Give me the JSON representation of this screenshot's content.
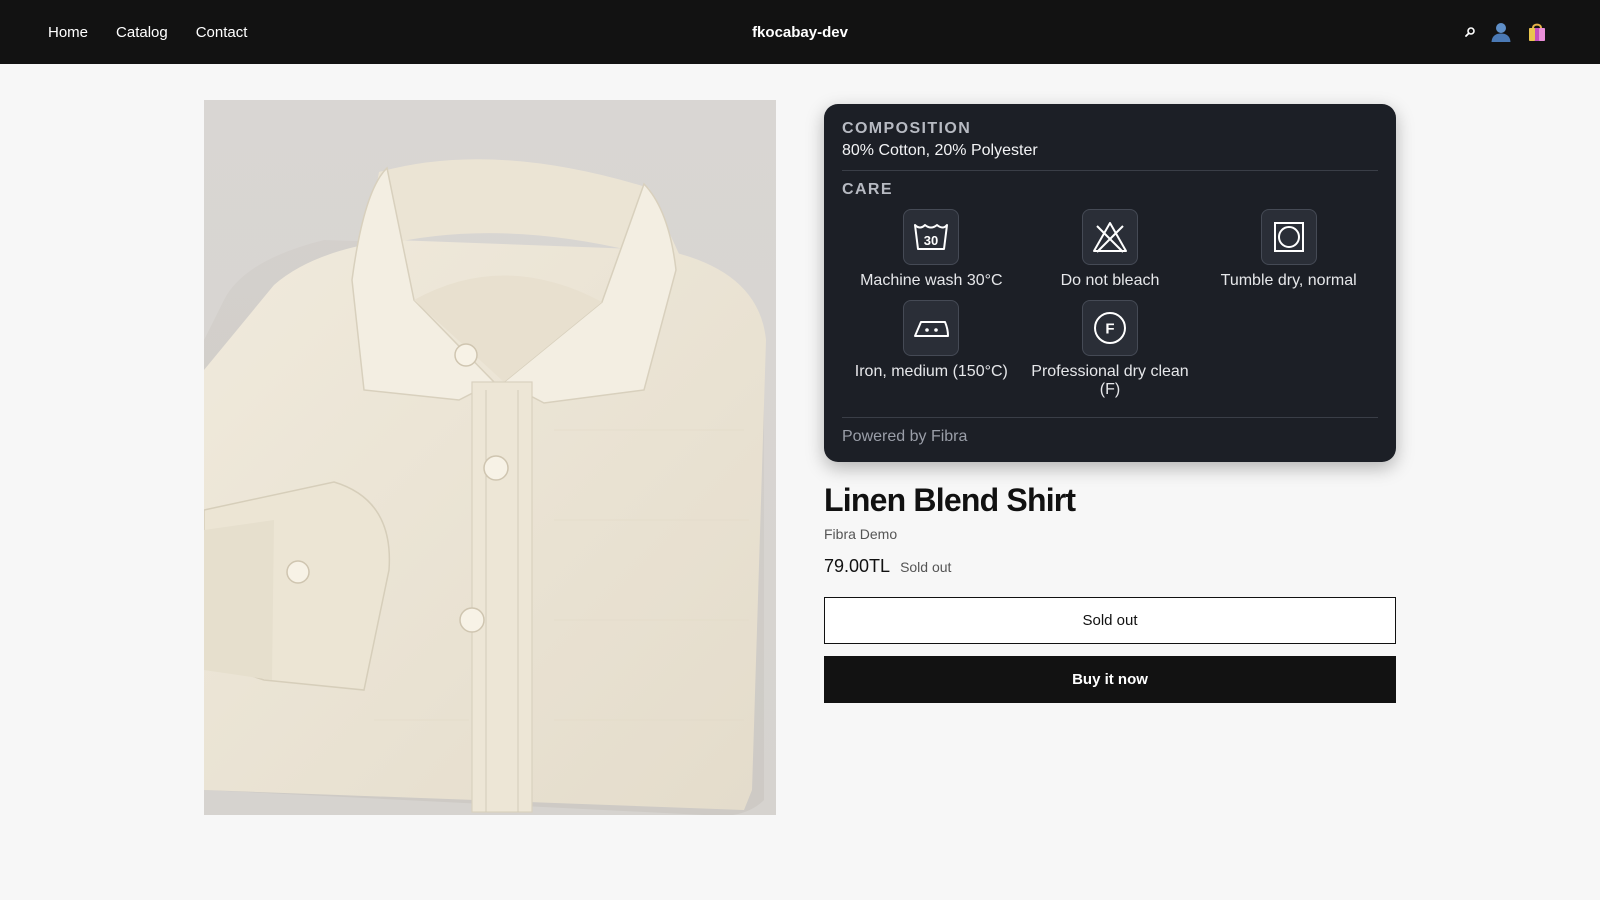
{
  "header": {
    "nav": [
      "Home",
      "Catalog",
      "Contact"
    ],
    "brand": "fkocabay-dev",
    "icons": [
      "search-icon",
      "account-icon",
      "cart-icon"
    ]
  },
  "product": {
    "title": "Linen Blend Shirt",
    "vendor": "Fibra Demo",
    "price": "79.00TL",
    "badge": "Sold out",
    "sold_out_button": "Sold out",
    "buy_now_button": "Buy it now"
  },
  "fibra": {
    "composition_label": "COMPOSITION",
    "composition_value": "80% Cotton, 20% Polyester",
    "care_label": "CARE",
    "care": [
      {
        "icon": "wash-30-icon",
        "label": "Machine wash 30°C",
        "symbol": "30"
      },
      {
        "icon": "no-bleach-icon",
        "label": "Do not bleach"
      },
      {
        "icon": "tumble-dry-icon",
        "label": "Tumble dry, normal"
      },
      {
        "icon": "iron-medium-icon",
        "label": "Iron, medium (150°C)"
      },
      {
        "icon": "dry-clean-f-icon",
        "label": "Professional dry clean (F)",
        "symbol": "F"
      }
    ],
    "powered_by": "Powered by Fibra"
  },
  "colors": {
    "header_bg": "#121212",
    "card_bg": "#1c1f26",
    "page_bg": "#f7f7f7",
    "cart_accent": "#c44fbf"
  }
}
